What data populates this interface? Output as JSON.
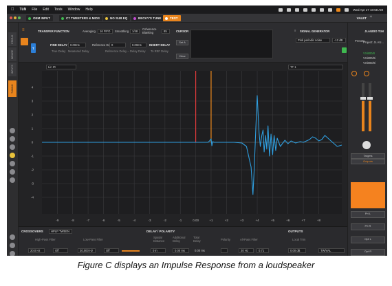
{
  "menubar": {
    "app": "TüN",
    "items": [
      "File",
      "Edit",
      "Tools",
      "Window",
      "Help"
    ],
    "clock": "Wed Apr 17  10:58 AM"
  },
  "tabs": [
    {
      "label": "OEM INPUT",
      "color": "#3fb950"
    },
    {
      "label": "C7 TWEETERS & MIDS",
      "color": "#3fb950"
    },
    {
      "label": "NO SUB EQ",
      "color": "#e9c23b"
    },
    {
      "label": "BECKY'S TUNE",
      "color": "#c14bd1"
    },
    {
      "label": "TEST",
      "color": "#ffffff",
      "active": true
    }
  ],
  "valet": "VALET",
  "leftbar": {
    "tabs": [
      "STATUS",
      "DEVICE",
      "INPUTS",
      "TUNING"
    ]
  },
  "transfer": {
    "title": "TRANSFER FUNCTION",
    "averaging_label": "Averaging",
    "averaging_value": "16 FIFO",
    "smoothing_label": "Smoothing",
    "smoothing_value": "1/48",
    "coherence_label": "Coherence Blanking",
    "coherence_value": "85",
    "find_delay_label": "FIND DELAY",
    "find_delay_value": "0.00ms",
    "true_delay": "True Delay",
    "measured_delay": "Measured Delay",
    "ref_delay_label": "Reference Delay",
    "ref_delay_value": "0",
    "ref_minus_delay": "Reference Delay − Delay Delay",
    "delay_value": "0.00ms",
    "insert_delay": "INSERT DELAY",
    "to_ref_delay": "To REF Delay",
    "letter_t": "T"
  },
  "cursor": {
    "title": "CURSOR",
    "set_a": "Set A",
    "clear": "Clear"
  },
  "signal": {
    "title": "SIGNAL GENERATOR",
    "type": "Pink periodic noise",
    "level": "-12 dB"
  },
  "graph": {
    "left_dropdown": "Lin IR",
    "right_dropdown": "TF 1",
    "zoom_label": "Zoom",
    "scale_label": "Scale",
    "explore_label": "Explore"
  },
  "chart_data": {
    "type": "line",
    "xlabel": "",
    "ylabel": "",
    "xlim": [
      -10,
      9.5
    ],
    "ylim": [
      -5.2,
      5.2
    ],
    "x_ticks": [
      "-9",
      "-8",
      "-7",
      "-6",
      "-5",
      "-4",
      "-3",
      "-2",
      "-1",
      "0.00",
      "+1",
      "+2",
      "+3",
      "+4",
      "+5",
      "+6",
      "+7",
      "+8"
    ],
    "x_tick_values": [
      -9,
      -8,
      -7,
      -6,
      -5,
      -4,
      -3,
      -2,
      -1,
      0,
      1,
      2,
      3,
      4,
      5,
      6,
      7,
      8
    ],
    "y_ticks": [
      "4",
      "3",
      "2",
      "1",
      "0",
      "-1",
      "-2",
      "-3",
      "-4"
    ],
    "y_tick_values": [
      4,
      3,
      2,
      1,
      0,
      -1,
      -2,
      -3,
      -4
    ],
    "grid": true,
    "markers": [
      {
        "name": "red",
        "x": 0.0,
        "color": "#e23b3b"
      },
      {
        "name": "orange",
        "x": 1.0,
        "color": "#f08a1c"
      }
    ],
    "series": [
      {
        "color": "#2f9fe0",
        "x": [
          -10,
          0.8,
          0.9,
          1.0,
          1.05,
          1.1,
          1.2,
          2.5,
          3.0,
          3.3,
          3.6,
          3.72,
          3.8,
          3.9,
          4.0,
          4.12,
          4.2,
          4.3,
          4.38,
          4.45,
          4.55,
          4.62,
          4.7,
          4.8,
          4.9,
          5.0,
          5.1,
          5.2,
          5.3,
          5.5,
          5.8,
          6.0,
          6.2,
          6.5,
          6.8,
          7.0,
          7.2,
          7.4,
          7.6,
          7.8,
          8.0,
          8.2,
          8.4,
          8.6,
          8.8,
          9.0,
          9.2,
          9.5
        ],
        "y": [
          0,
          0,
          0.1,
          0.25,
          -0.25,
          0.05,
          0,
          0,
          -0.05,
          -0.3,
          -1.8,
          -3.8,
          -2.0,
          0.8,
          3.4,
          0.7,
          -0.3,
          0.5,
          0.9,
          -0.7,
          0.5,
          -0.5,
          1.2,
          -1.0,
          0.6,
          -0.9,
          0.5,
          -0.6,
          0.3,
          -0.3,
          0.15,
          -0.1,
          0.1,
          -0.05,
          0.05,
          0,
          0.1,
          0.2,
          0.4,
          0.3,
          0.1,
          0.2,
          0.5,
          0.3,
          0.1,
          -0.1,
          -0.3,
          -0.2
        ]
      }
    ]
  },
  "bottom": {
    "crossovers_title": "CROSSOVERS",
    "crossover_name": "HPLP TWEEN",
    "hpf": "High-Pass Filter",
    "lpf": "Low-Pass Filter",
    "hp_freq": "20.0 Hz",
    "hp_type": "Off",
    "lp_freq": "20,000 Hz",
    "lp_type": "Off",
    "delay_title": "DELAY / POLARITY",
    "spatial": "Spatial Distance",
    "additional": "Additional Delay",
    "total": "Total Delay",
    "polarity": "Polarity",
    "allpass": "All-Pass Filter",
    "d_in": "0 in",
    "d_ms": "0.00 ms",
    "d_total": "0.00 ms",
    "allpass_val": "20 Hz",
    "q_val": "0.71",
    "outputs_title": "OUTPUTS",
    "local_trim": "Local Trim",
    "trim_val": "0.00 dB",
    "channel": "TW/VAL"
  },
  "rightbar": {
    "brand": "JLAUDIO TüN",
    "project": "Project: JL AU...",
    "device": "VXi800/8",
    "dev_a": "VXi800/8i",
    "dev_b": "VXi800/8i",
    "targets": "Targets",
    "outputs": "Outputs",
    "pri_l": "Pri L",
    "pri_r": "Pri R",
    "opt_l": "Opt L",
    "opt_r": "Opt R",
    "presets": "Presets"
  },
  "caption": "Figure C displays an Impulse Response from a loudspeaker"
}
